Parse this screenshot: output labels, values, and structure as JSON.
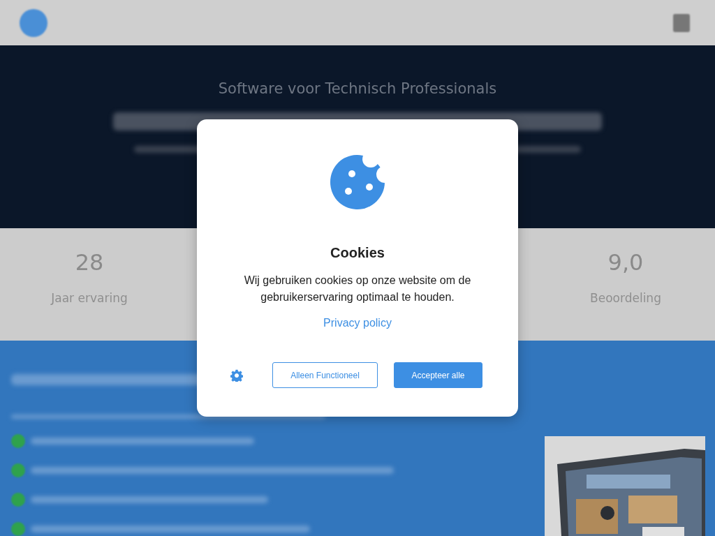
{
  "background_page": {
    "hero": {
      "subtitle": "Software voor Technisch Professionals"
    },
    "stats": [
      {
        "value": "28",
        "label": "Jaar ervaring"
      },
      {
        "value": "9,0",
        "label": "Beoordeling"
      }
    ],
    "feature_list": {
      "items": [
        {
          "kind": "check"
        },
        {
          "kind": "check"
        },
        {
          "kind": "check"
        },
        {
          "kind": "check"
        }
      ]
    }
  },
  "cookie_dialog": {
    "title": "Cookies",
    "message": "Wij gebruiken cookies op onze website om de gebruikerservaring optimaal te houden.",
    "link": "Privacy policy",
    "buttons": [
      {
        "label": "Alleen Functioneel",
        "kind": "outline"
      },
      {
        "label": "Accepteer alle",
        "kind": "primary"
      }
    ]
  }
}
